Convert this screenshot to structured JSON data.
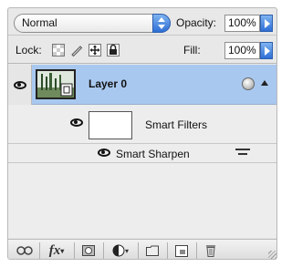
{
  "blend_mode": {
    "value": "Normal"
  },
  "opacity": {
    "label": "Opacity:",
    "value": "100%"
  },
  "lock": {
    "label": "Lock:"
  },
  "fill": {
    "label": "Fill:",
    "value": "100%"
  },
  "layers": [
    {
      "name": "Layer 0",
      "selected": true,
      "visible": true
    }
  ],
  "smart_filters": {
    "label": "Smart Filters",
    "visible": true
  },
  "filters": [
    {
      "name": "Smart Sharpen",
      "visible": true
    }
  ],
  "colors": {
    "selection": "#a9c8ef",
    "panel": "#e8e8e8",
    "accent": "#2e6fd6"
  },
  "bottom_icons": [
    "link-icon",
    "fx-icon",
    "mask-icon",
    "adjustment-icon",
    "folder-icon",
    "new-layer-icon",
    "trash-icon"
  ]
}
